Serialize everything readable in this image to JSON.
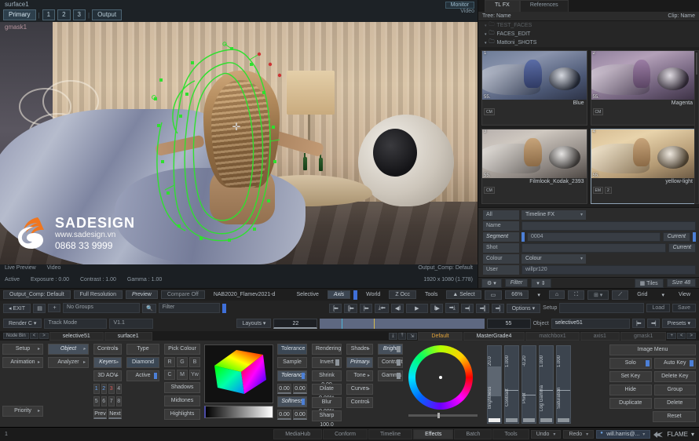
{
  "viewer": {
    "surface_label": "surface1",
    "tabs": [
      {
        "label": "Primary",
        "selected": true
      },
      {
        "label": "1",
        "selected": false
      },
      {
        "label": "2",
        "selected": false
      },
      {
        "label": "3",
        "selected": false
      },
      {
        "label": "Output",
        "selected": false
      }
    ],
    "monitor": {
      "line1": "Monitor",
      "line2": "Video"
    },
    "gmask_label": "gmask1",
    "watermark": {
      "brand": "SADESIGN",
      "site": "www.sadesign.vn",
      "phone": "0868 33 9999"
    },
    "info_row1": {
      "mode": "Live Preview",
      "source": "Video",
      "status": "Active",
      "exposure": "Exposure : 0.00",
      "contrast": "Contrast : 1.00",
      "gamma": "Gamma : 1.00",
      "right1": "Output_Comp: Default",
      "right2": "1920 x 1080 (1.778)"
    },
    "info_row2": {
      "comp": "Output_Comp: Default",
      "resolution": "Full Resolution",
      "preview": "Preview",
      "compare": "Compare Off",
      "clip": "NAB2020_Flamev2021-d",
      "selective_label": "Selective",
      "axis": "Axis",
      "world": "World",
      "zocc": "Z Occ",
      "tools": "Tools"
    }
  },
  "media": {
    "tabs": [
      {
        "label": "TL FX",
        "selected": true
      },
      {
        "label": "References",
        "selected": false
      }
    ],
    "tree_header": {
      "left": "Tree: Name",
      "right": "Clip: Name"
    },
    "tree_rows": [
      {
        "label": "TEST_FACES",
        "faded": true
      },
      {
        "label": "FACES_EDIT",
        "faded": false
      },
      {
        "label": "Mattoni_SHOTS",
        "faded": false
      }
    ],
    "thumbnails": [
      {
        "num": "1",
        "fps": "55.",
        "name": "Blue",
        "badges": [
          "CM"
        ],
        "scene": "blue",
        "selected": false
      },
      {
        "num": "2",
        "fps": "55.",
        "name": "Magenta",
        "badges": [
          "CM"
        ],
        "scene": "mag",
        "selected": false
      },
      {
        "num": "3",
        "fps": "55.",
        "name": "Filmlook_Kodak_2393",
        "badges": [
          "CM"
        ],
        "scene": "kodak",
        "selected": false
      },
      {
        "num": "4",
        "fps": "55.",
        "name": "yellow-light",
        "badges": [
          "EM",
          "2"
        ],
        "scene": "yellow",
        "selected": true
      }
    ],
    "props": {
      "all": "All",
      "timeline_fx": "Timeline FX",
      "name_label": "Name",
      "name_value": "",
      "segment_label": "Segment",
      "segment_value": "0004",
      "segment_current": "Current",
      "shot_label": "Shot",
      "shot_value": "",
      "shot_current": "Current",
      "colour_label": "Colour",
      "colour_value": "Colour",
      "user_label": "User",
      "user_value": "willpr120",
      "filter": "Filter",
      "tiles": "Tiles",
      "size": "Size 48"
    }
  },
  "toolbar": {
    "exit": "EXIT",
    "no_groups": "No Groups",
    "filter": "Filter",
    "render": "Render C",
    "track_mode": "Track Mode",
    "version": "V1.1",
    "layouts": "Layouts",
    "frame": "22",
    "frame_end": "55",
    "options": "Options",
    "setup_label": "Setup",
    "setup_value": "",
    "load": "Load",
    "save": "Save",
    "object_label": "Object",
    "object_value": "selective51",
    "presets": "Presets",
    "tools_label": "Tools",
    "select": "Select",
    "zoom": "66%",
    "grid": "Grid",
    "view": "View"
  },
  "nodetabs": {
    "node_bin": "Node Bin",
    "bin_a": "selective51",
    "bin_b": "surface1",
    "tabs": [
      {
        "label": "Default",
        "state": "active"
      },
      {
        "label": "MasterGrade4",
        "state": "lit"
      },
      {
        "label": "matchbox1",
        "state": "dim"
      },
      {
        "label": "axis1",
        "state": "dim"
      },
      {
        "label": "gmask1",
        "state": "dim"
      }
    ]
  },
  "panel": {
    "col1": [
      {
        "label": "Setup",
        "arrow": true
      },
      {
        "label": "Animation",
        "arrow": true
      },
      {
        "label": "Priority",
        "arrow": true
      }
    ],
    "col2": [
      {
        "label": "Object",
        "arrow": true,
        "sel": true
      },
      {
        "label": "Analyzer",
        "arrow": true
      }
    ],
    "col3": [
      {
        "label": "Controls",
        "arrow": true
      },
      {
        "label": "Keyers",
        "arrow": true,
        "sel": true
      },
      {
        "label": "3D AOV",
        "arrow": true
      }
    ],
    "col3_nums_a": [
      "1",
      "2",
      "3",
      "4"
    ],
    "col3_nums_b": [
      "5",
      "6",
      "7",
      "8"
    ],
    "col3_prev": "Prev",
    "col3_next": "Next",
    "col4": [
      {
        "label": "Type"
      },
      {
        "label": "Diamond",
        "blue": true
      },
      {
        "label": "Active",
        "toggle": true
      }
    ],
    "col5": [
      {
        "label": "Pick Colour"
      },
      {
        "label": "Shadows"
      },
      {
        "label": "Midtones"
      },
      {
        "label": "Highlights"
      }
    ],
    "col5_rgb": [
      "R",
      "G",
      "B"
    ],
    "col5_cmy": [
      "C",
      "M",
      "Yw"
    ],
    "tolerance": {
      "header": "Tolerance",
      "sample": "Sample",
      "tolerance": "Tolerance",
      "tol_a": "0.00",
      "tol_b": "0.00",
      "softness": "Softness",
      "soft_a": "0.00",
      "soft_b": "0.00"
    },
    "rendering": {
      "header": "Rendering",
      "invert": "Invert",
      "shrink": "Shrink 0.00",
      "dilate": "Dilate 0.00%",
      "blur": "Blur 0.00%",
      "sharp": "Sharp 100.0"
    },
    "shader": [
      {
        "label": "Shader",
        "arrow": true
      },
      {
        "label": "Primary",
        "arrow": true,
        "sel": true
      },
      {
        "label": "Tone",
        "arrow": true
      },
      {
        "label": "Curves",
        "arrow": true
      },
      {
        "label": "Control",
        "arrow": true
      }
    ],
    "grade": [
      {
        "label": "Bright",
        "toggle": true
      },
      {
        "label": "Contrast",
        "toggle": true
      },
      {
        "label": "Gamma",
        "toggle": true
      }
    ],
    "sliders": [
      {
        "name": "Brightness",
        "value": "20.0",
        "fill": 42,
        "white": true
      },
      {
        "name": "Contrast",
        "value": "1.000",
        "fill": 0,
        "line": 32
      },
      {
        "name": "Pivot",
        "value": "-0.20",
        "fill": 0,
        "line": 52
      },
      {
        "name": "Log Gamma",
        "value": "1.000",
        "fill": 0,
        "line": 32
      },
      {
        "name": "Saturation",
        "value": "1.000",
        "fill": 0,
        "line": 32
      }
    ],
    "right_buttons": [
      [
        {
          "label": "Image Menu",
          "wide": true
        }
      ],
      [
        {
          "label": "Solo",
          "toggle": true
        },
        {
          "label": "Auto Key",
          "toggle": true
        }
      ],
      [
        {
          "label": "Set Key"
        },
        {
          "label": "Delete Key"
        }
      ],
      [
        {
          "label": "Hide"
        },
        {
          "label": "Group"
        }
      ],
      [
        {
          "label": "Duplicate"
        },
        {
          "label": "Delete"
        }
      ],
      [
        {
          "label": "Reset",
          "half": true
        }
      ]
    ]
  },
  "status": {
    "index": "1",
    "tabs": [
      {
        "label": "MediaHub",
        "active": false
      },
      {
        "label": "Conform",
        "active": false
      },
      {
        "label": "Timeline",
        "active": false
      },
      {
        "label": "Effects",
        "active": true
      },
      {
        "label": "Batch",
        "active": false
      },
      {
        "label": "Tools",
        "active": false
      }
    ],
    "undo": "Undo",
    "redo": "Redo",
    "user": "will.harris@...",
    "app": "FLAME"
  }
}
